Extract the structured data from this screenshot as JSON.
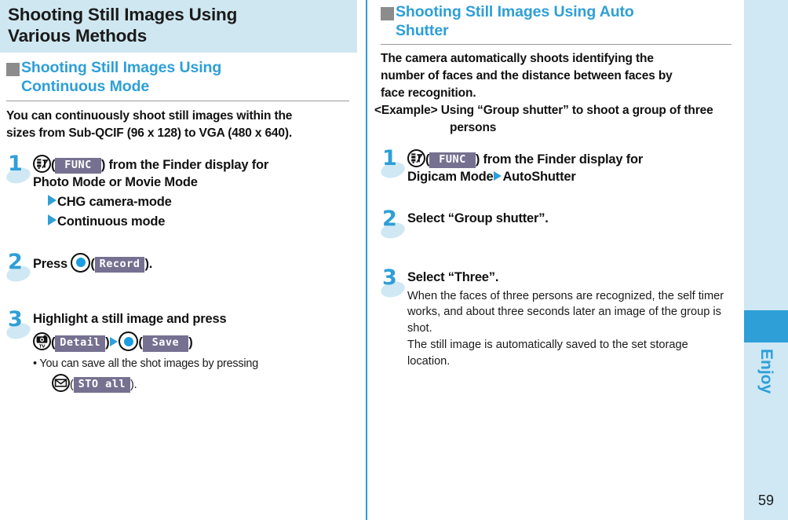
{
  "chapter": {
    "title_line1": "Shooting Still Images Using",
    "title_line2": "Various Methods"
  },
  "left": {
    "section_title_line1": "Shooting Still Images Using",
    "section_title_line2": "Continuous Mode",
    "lead_line1": "You can continuously shoot still images within the",
    "lead_line2": "sizes from Sub-QCIF (96 x 128) to VGA (480 x 640).",
    "steps": [
      {
        "num": "1",
        "chip": "FUNC",
        "text_after_chip": ") from the Finder display for",
        "line2": "Photo Mode or Movie Mode",
        "sub1": "CHG camera-mode",
        "sub2": "Continuous mode"
      },
      {
        "num": "2",
        "press_label": "Press",
        "chip": "Record",
        "tail": ")."
      },
      {
        "num": "3",
        "line1": "Highlight a still image and press",
        "chip_detail": "Detail",
        "chip_save": "Save",
        "bullet": "• You can save all the shot images by pressing",
        "chip_stoall": "STO all",
        "bullet_tail": ")."
      }
    ]
  },
  "right": {
    "section_title_line1": "Shooting Still Images Using Auto",
    "section_title_line2": "Shutter",
    "lead_line1": "The camera automatically shoots identifying the",
    "lead_line2": "number of faces and the distance between faces by",
    "lead_line3": "face recognition.",
    "example_label": "<Example>",
    "example_text": "Using “Group shutter” to shoot a group of three persons",
    "steps": [
      {
        "num": "1",
        "chip": "FUNC",
        "text_after_chip": ") from the Finder display for",
        "line2_a": "Digicam Mode",
        "line2_b": "AutoShutter"
      },
      {
        "num": "2",
        "line1": "Select “Group shutter”."
      },
      {
        "num": "3",
        "line1": "Select “Three”.",
        "para1": "When the faces of three persons are recognized, the self timer works, and about three seconds later an image of the group is shot.",
        "para2": "The still image is automatically saved to the set storage location."
      }
    ]
  },
  "sidebar": {
    "label": "Enjoy",
    "page_number": "59"
  },
  "colors": {
    "accent_blue": "#2e9fd7",
    "band_blue": "#cfe7f0",
    "chip_purple": "#767191",
    "marker_gray": "#8c8c8c"
  }
}
